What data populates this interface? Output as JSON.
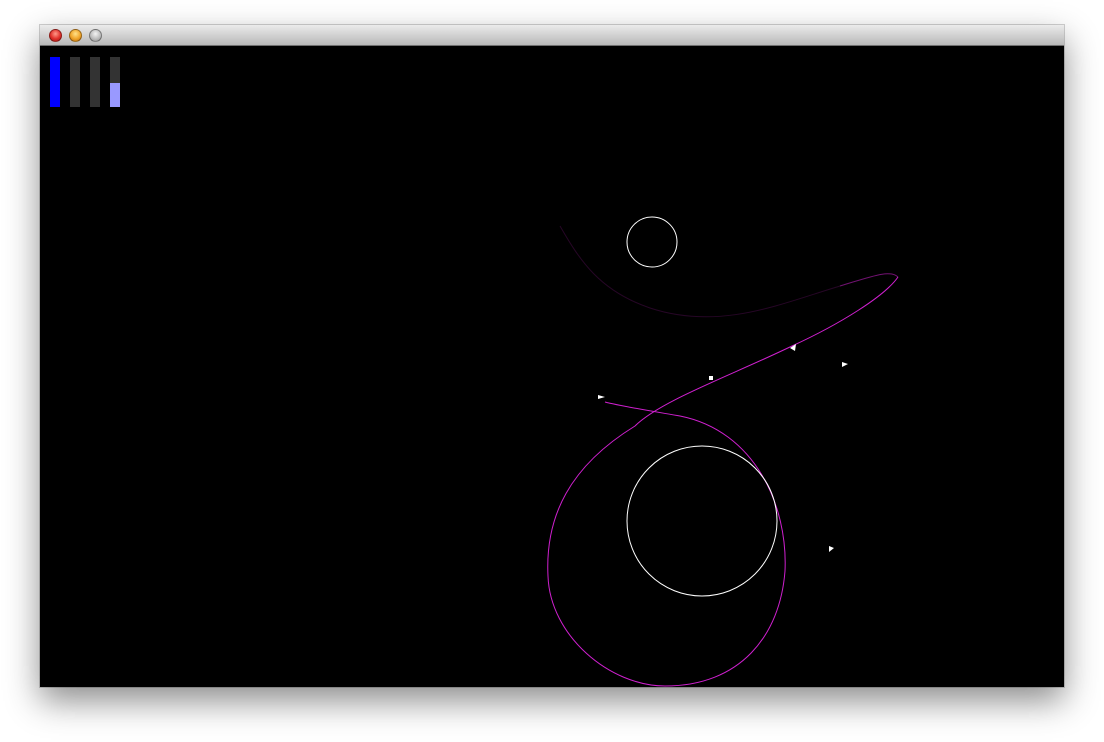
{
  "window": {
    "controls": [
      "close-button",
      "minimize-button",
      "zoom-button"
    ]
  },
  "gauges": [
    {
      "name": "gauge-1",
      "level": 1.0,
      "color": "#0000ff"
    },
    {
      "name": "gauge-2",
      "level": 0.0,
      "color": "#0000ff"
    },
    {
      "name": "gauge-3",
      "level": 0.0,
      "color": "#0000ff"
    },
    {
      "name": "gauge-4",
      "level": 0.48,
      "color": "#9999ff"
    }
  ],
  "colors": {
    "background": "#000000",
    "orbit_trail": "#d020d0",
    "planet_outline": "#ffffff",
    "gauge_track": "#333333"
  },
  "scene": {
    "planets": [
      "small-planet",
      "large-planet"
    ],
    "ship": "ship",
    "markers": [
      "marker-1",
      "marker-2",
      "marker-3",
      "marker-4"
    ]
  }
}
